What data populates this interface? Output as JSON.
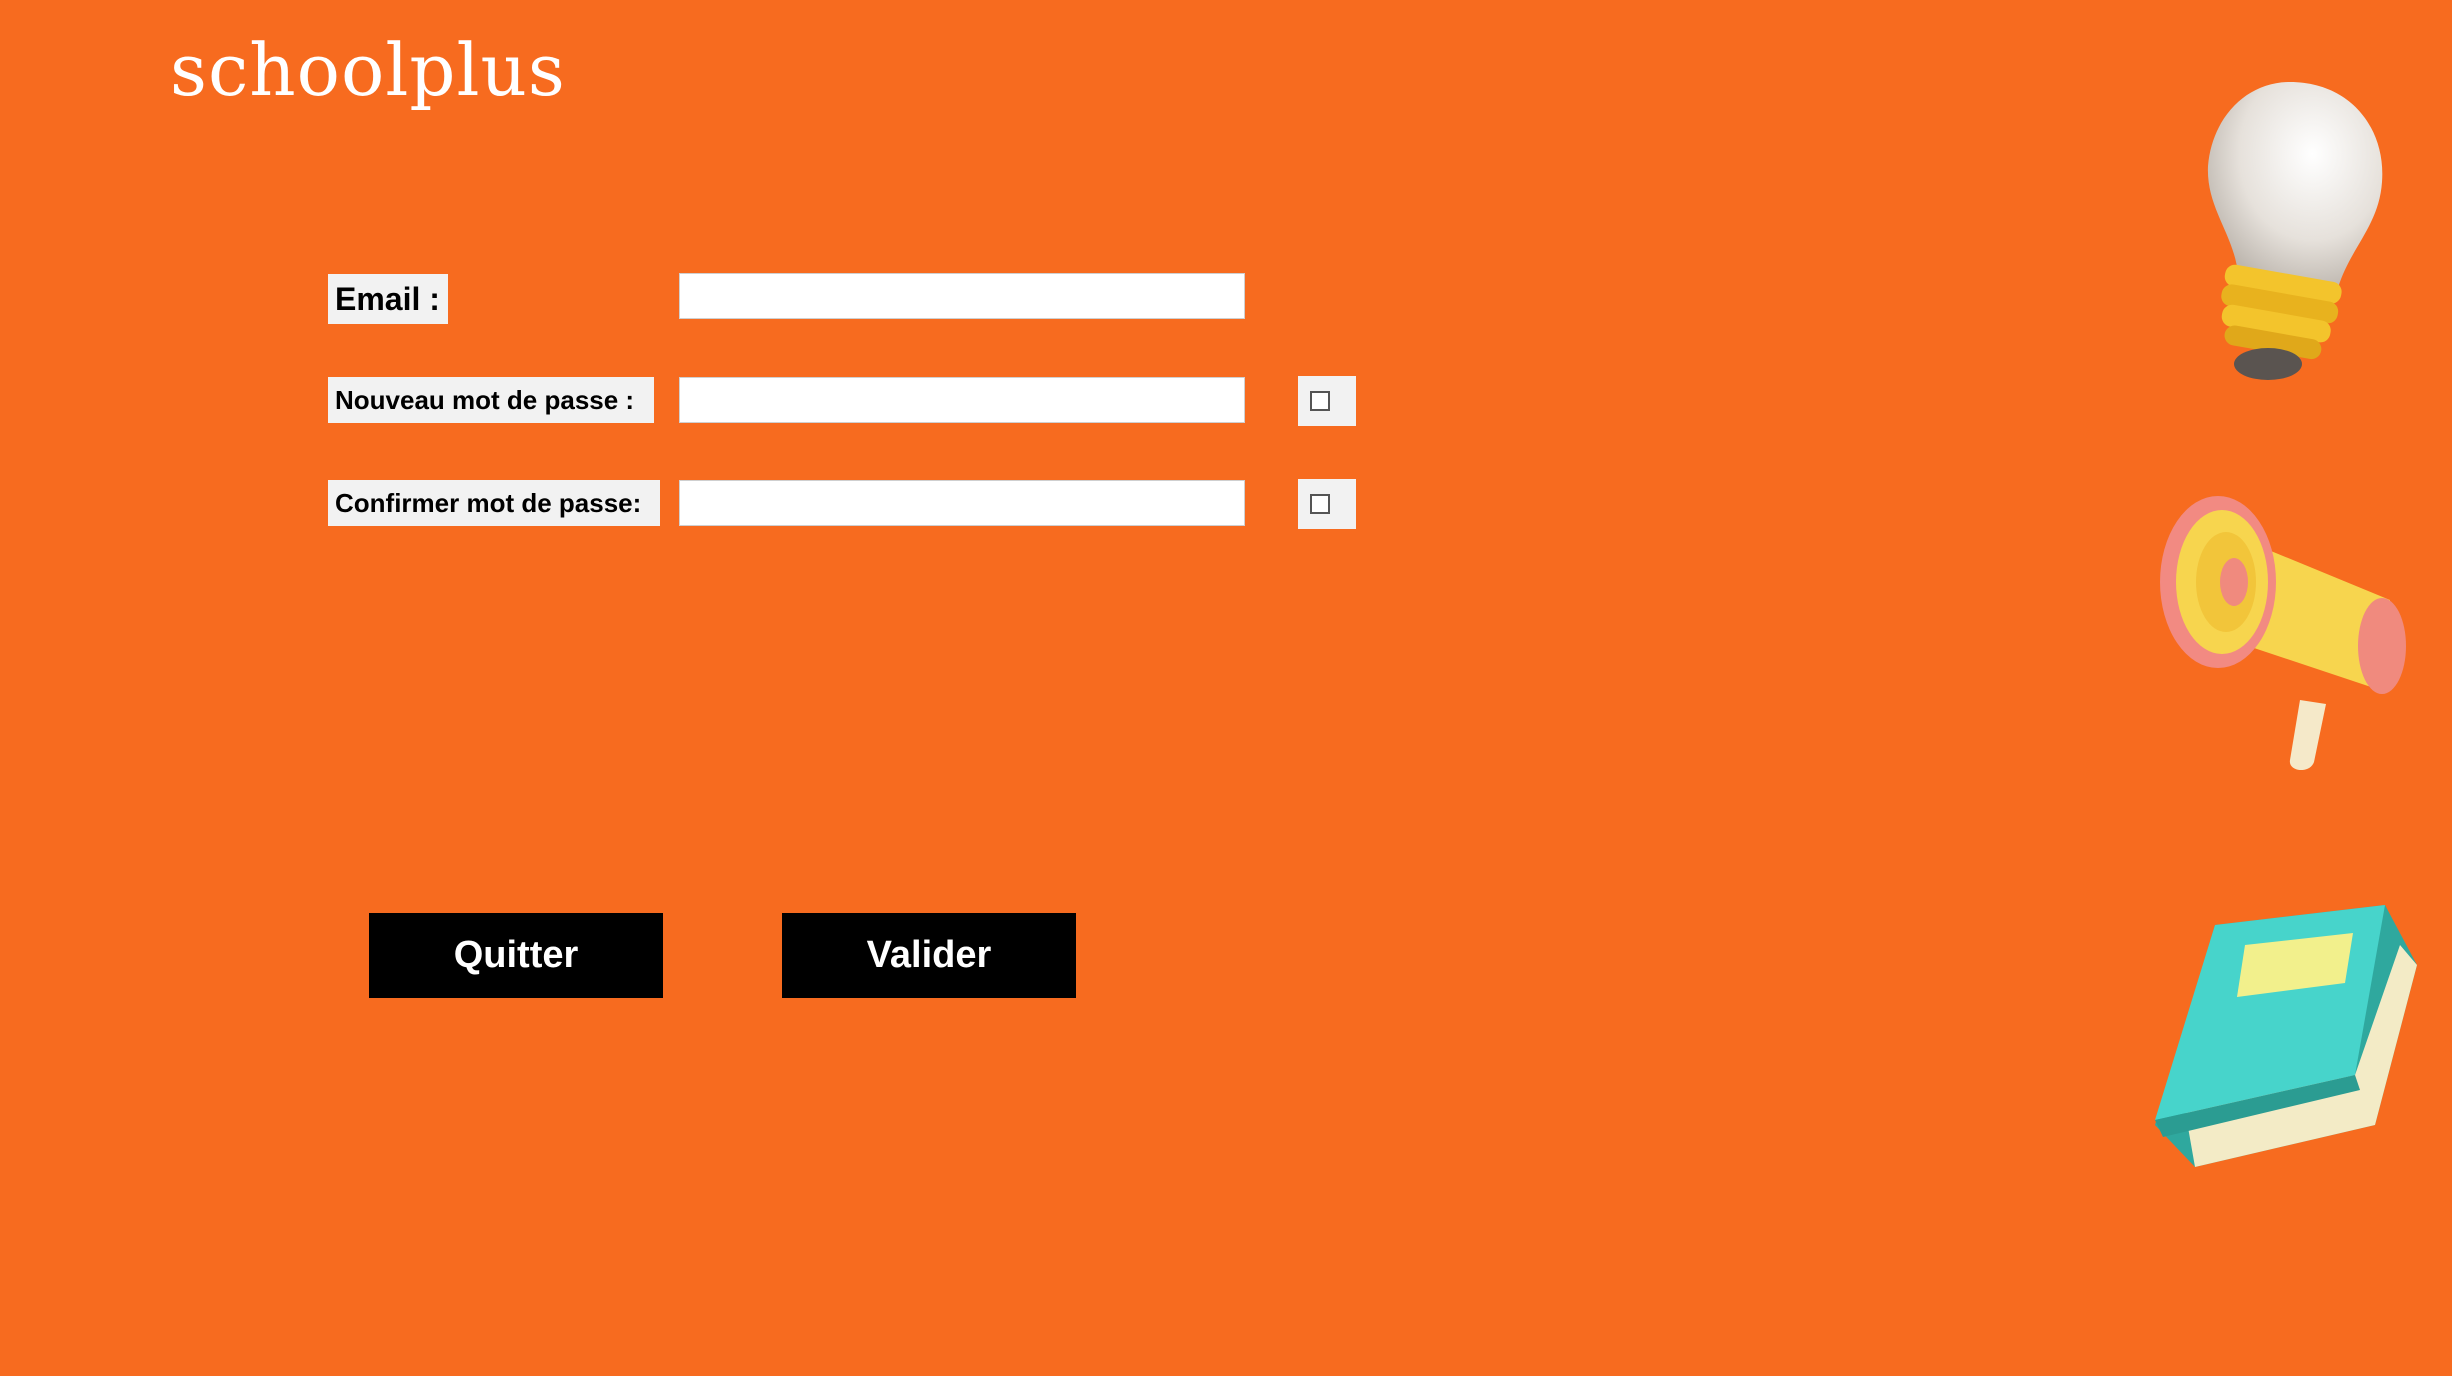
{
  "app": {
    "logo_text": "schoolplus"
  },
  "form": {
    "email_label": "Email :",
    "email_value": "",
    "new_password_label": "Nouveau mot de passe :",
    "new_password_value": "",
    "new_password_show_checked": false,
    "confirm_password_label": "Confirmer mot de passe:",
    "confirm_password_value": "",
    "confirm_password_show_checked": false
  },
  "buttons": {
    "quit_label": "Quitter",
    "validate_label": "Valider"
  },
  "theme": {
    "background": "#f76b1f",
    "button_bg": "#000000",
    "button_text": "#ffffff"
  },
  "decorations": [
    "lightbulb-icon",
    "megaphone-icon",
    "book-icon"
  ]
}
